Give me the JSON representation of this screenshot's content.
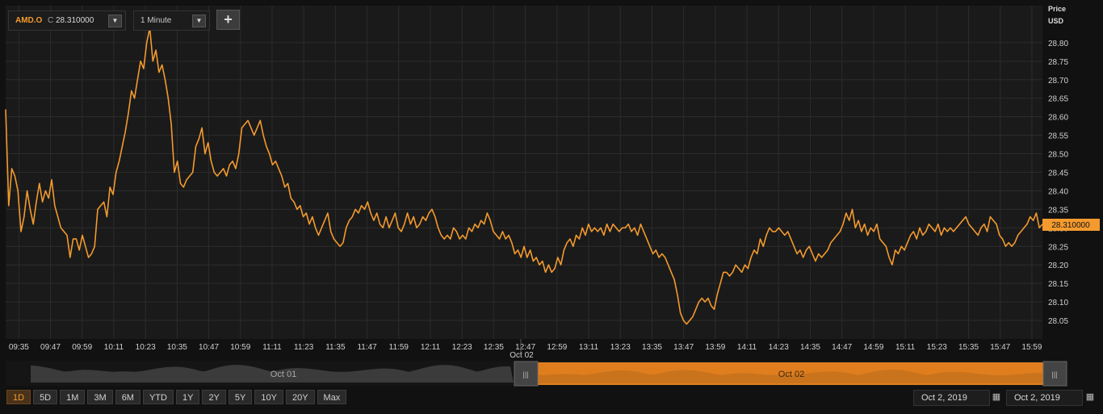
{
  "toolbar": {
    "symbol": "AMD.O",
    "close_prefix": "C",
    "close_value": "28.310000",
    "interval": "1 Minute",
    "add_label": "+"
  },
  "axis": {
    "price_label": "Price",
    "currency_label": "USD",
    "last_price_label": "28.310000"
  },
  "navigator": {
    "left_label": "Oct 01",
    "right_label": "Oct 02",
    "handle_glyph": "|||"
  },
  "ranges": [
    "1D",
    "5D",
    "1M",
    "3M",
    "6M",
    "YTD",
    "1Y",
    "2Y",
    "5Y",
    "10Y",
    "20Y",
    "Max"
  ],
  "active_range": "1D",
  "dates": {
    "from": "Oct 2, 2019",
    "to": "Oct 2, 2019"
  },
  "colors": {
    "line": "#f39a2e",
    "background": "#1a1a1a",
    "grid": "#2c2c2c",
    "accent": "#f39a2e"
  },
  "icons": {
    "dropdown": "caret-down-icon",
    "add": "plus-icon",
    "calendar": "calendar-icon"
  },
  "chart_data": {
    "type": "line",
    "ylabel": "Price USD",
    "y_ticks": [
      "28.05",
      "28.10",
      "28.15",
      "28.20",
      "28.25",
      "28.30",
      "28.35",
      "28.40",
      "28.45",
      "28.50",
      "28.55",
      "28.60",
      "28.65",
      "28.70",
      "28.75",
      "28.80"
    ],
    "x_ticks": [
      "09:35",
      "09:47",
      "09:59",
      "10:11",
      "10:23",
      "10:35",
      "10:47",
      "10:59",
      "11:11",
      "11:23",
      "11:35",
      "11:47",
      "11:59",
      "12:11",
      "12:23",
      "12:35",
      "12:47",
      "12:59",
      "13:11",
      "13:23",
      "13:35",
      "13:47",
      "13:59",
      "14:11",
      "14:23",
      "14:35",
      "14:47",
      "14:59",
      "15:11",
      "15:23",
      "15:35",
      "15:47",
      "15:59"
    ],
    "date_marker": {
      "at": "12:47",
      "label": "Oct 02"
    },
    "ylim": [
      28.0,
      28.9
    ],
    "start": "09:30",
    "end": "16:03",
    "series": [
      {
        "values": [
          28.62,
          28.36,
          28.46,
          28.44,
          28.4,
          28.29,
          28.33,
          28.4,
          28.35,
          28.31,
          28.37,
          28.42,
          28.37,
          28.4,
          28.38,
          28.43,
          28.36,
          28.33,
          28.3,
          28.29,
          28.28,
          28.22,
          28.27,
          28.27,
          28.24,
          28.28,
          28.25,
          28.22,
          28.23,
          28.25,
          28.35,
          28.36,
          28.37,
          28.33,
          28.41,
          28.39,
          28.45,
          28.48,
          28.52,
          28.56,
          28.61,
          28.67,
          28.65,
          28.7,
          28.75,
          28.73,
          28.8,
          28.84,
          28.75,
          28.78,
          28.72,
          28.74,
          28.7,
          28.65,
          28.58,
          28.45,
          28.48,
          28.42,
          28.41,
          28.43,
          28.44,
          28.45,
          28.52,
          28.54,
          28.57,
          28.5,
          28.53,
          28.48,
          28.45,
          28.44,
          28.45,
          28.46,
          28.44,
          28.47,
          28.48,
          28.46,
          28.5,
          28.57,
          28.58,
          28.59,
          28.57,
          28.55,
          28.57,
          28.59,
          28.55,
          28.52,
          28.5,
          28.47,
          28.48,
          28.46,
          28.44,
          28.41,
          28.42,
          28.38,
          28.37,
          28.35,
          28.36,
          28.33,
          28.34,
          28.31,
          28.33,
          28.3,
          28.28,
          28.3,
          28.32,
          28.34,
          28.29,
          28.27,
          28.26,
          28.25,
          28.26,
          28.3,
          28.32,
          28.33,
          28.35,
          28.34,
          28.36,
          28.35,
          28.37,
          28.34,
          28.32,
          28.34,
          28.31,
          28.3,
          28.33,
          28.3,
          28.32,
          28.34,
          28.3,
          28.29,
          28.31,
          28.34,
          28.31,
          28.33,
          28.3,
          28.31,
          28.33,
          28.32,
          28.34,
          28.35,
          28.33,
          28.3,
          28.28,
          28.27,
          28.28,
          28.27,
          28.3,
          28.29,
          28.27,
          28.28,
          28.27,
          28.3,
          28.29,
          28.31,
          28.3,
          28.32,
          28.31,
          28.34,
          28.32,
          28.29,
          28.28,
          28.27,
          28.29,
          28.27,
          28.28,
          28.26,
          28.23,
          28.24,
          28.22,
          28.25,
          28.22,
          28.24,
          28.21,
          28.22,
          28.2,
          28.21,
          28.18,
          28.2,
          28.18,
          28.19,
          28.22,
          28.2,
          28.24,
          28.26,
          28.27,
          28.25,
          28.28,
          28.27,
          28.3,
          28.28,
          28.31,
          28.29,
          28.3,
          28.29,
          28.3,
          28.28,
          28.31,
          28.29,
          28.31,
          28.3,
          28.29,
          28.3,
          28.3,
          28.31,
          28.29,
          28.3,
          28.28,
          28.31,
          28.29,
          28.27,
          28.25,
          28.23,
          28.24,
          28.22,
          28.23,
          28.22,
          28.2,
          28.18,
          28.16,
          28.12,
          28.07,
          28.05,
          28.04,
          28.05,
          28.06,
          28.08,
          28.1,
          28.11,
          28.1,
          28.11,
          28.09,
          28.08,
          28.12,
          28.15,
          28.18,
          28.18,
          28.17,
          28.18,
          28.2,
          28.19,
          28.18,
          28.2,
          28.19,
          28.22,
          28.24,
          28.23,
          28.27,
          28.25,
          28.28,
          28.3,
          28.29,
          28.29,
          28.3,
          28.29,
          28.28,
          28.29,
          28.27,
          28.25,
          28.23,
          28.24,
          28.22,
          28.24,
          28.25,
          28.23,
          28.21,
          28.23,
          28.22,
          28.23,
          28.24,
          28.26,
          28.27,
          28.28,
          28.29,
          28.31,
          28.34,
          28.32,
          28.35,
          28.3,
          28.32,
          28.29,
          28.31,
          28.28,
          28.3,
          28.29,
          28.31,
          28.27,
          28.26,
          28.25,
          28.22,
          28.2,
          28.24,
          28.23,
          28.25,
          28.24,
          28.26,
          28.28,
          28.29,
          28.27,
          28.3,
          28.28,
          28.29,
          28.31,
          28.3,
          28.29,
          28.31,
          28.28,
          28.3,
          28.29,
          28.3,
          28.29,
          28.3,
          28.31,
          28.32,
          28.33,
          28.31,
          28.3,
          28.29,
          28.28,
          28.3,
          28.31,
          28.29,
          28.33,
          28.32,
          28.31,
          28.28,
          28.27,
          28.25,
          28.26,
          28.25,
          28.26,
          28.28,
          28.29,
          28.3,
          28.31,
          28.33,
          28.32,
          28.34,
          28.3,
          28.31
        ]
      }
    ]
  }
}
